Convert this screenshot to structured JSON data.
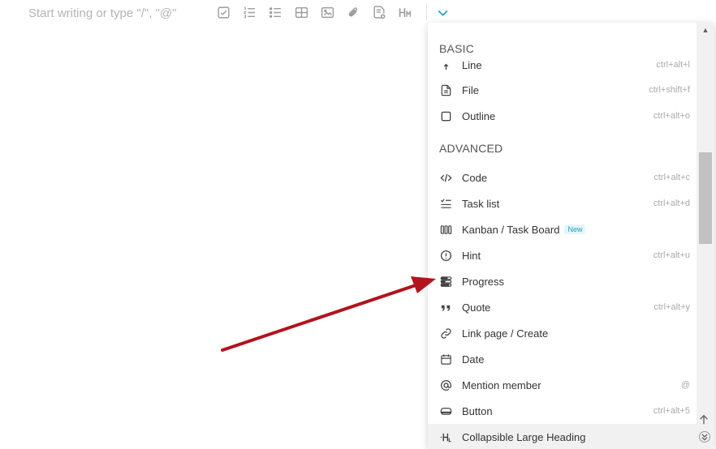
{
  "editor": {
    "placeholder": "Start writing or type \"/\", \"@\""
  },
  "toolbar": {
    "icons": [
      "checkbox-icon",
      "numbered-list-icon",
      "bullet-list-icon",
      "table-icon",
      "image-icon",
      "attachment-icon",
      "template-icon",
      "heading-icon",
      "chevron-down-icon"
    ]
  },
  "menu": {
    "basic_header": "BASIC",
    "advanced_header": "ADVANCED",
    "basic_items": [
      {
        "label": "Line",
        "shortcut": "ctrl+alt+l",
        "icon": "line-icon"
      },
      {
        "label": "File",
        "shortcut": "ctrl+shift+f",
        "icon": "file-icon"
      },
      {
        "label": "Outline",
        "shortcut": "ctrl+alt+o",
        "icon": "outline-icon"
      }
    ],
    "advanced_items": [
      {
        "label": "Code",
        "shortcut": "ctrl+alt+c",
        "icon": "code-icon"
      },
      {
        "label": "Task list",
        "shortcut": "ctrl+alt+d",
        "icon": "task-list-icon"
      },
      {
        "label": "Kanban / Task Board",
        "shortcut": "",
        "badge": "New",
        "icon": "kanban-icon"
      },
      {
        "label": "Hint",
        "shortcut": "ctrl+alt+u",
        "icon": "hint-icon"
      },
      {
        "label": "Progress",
        "shortcut": "",
        "icon": "progress-icon"
      },
      {
        "label": "Quote",
        "shortcut": "ctrl+alt+y",
        "icon": "quote-icon"
      },
      {
        "label": "Link page / Create",
        "shortcut": "",
        "icon": "link-icon"
      },
      {
        "label": "Date",
        "shortcut": "",
        "icon": "calendar-icon"
      },
      {
        "label": "Mention member",
        "shortcut": "@",
        "icon": "at-icon"
      },
      {
        "label": "Button",
        "shortcut": "ctrl+alt+5",
        "icon": "button-icon"
      },
      {
        "label": "Collapsible Large Heading",
        "shortcut": "",
        "icon": "collapsible-heading-icon"
      }
    ]
  },
  "colors": {
    "accent": "#1a9fc7",
    "annotation_arrow": "#b0141c"
  }
}
